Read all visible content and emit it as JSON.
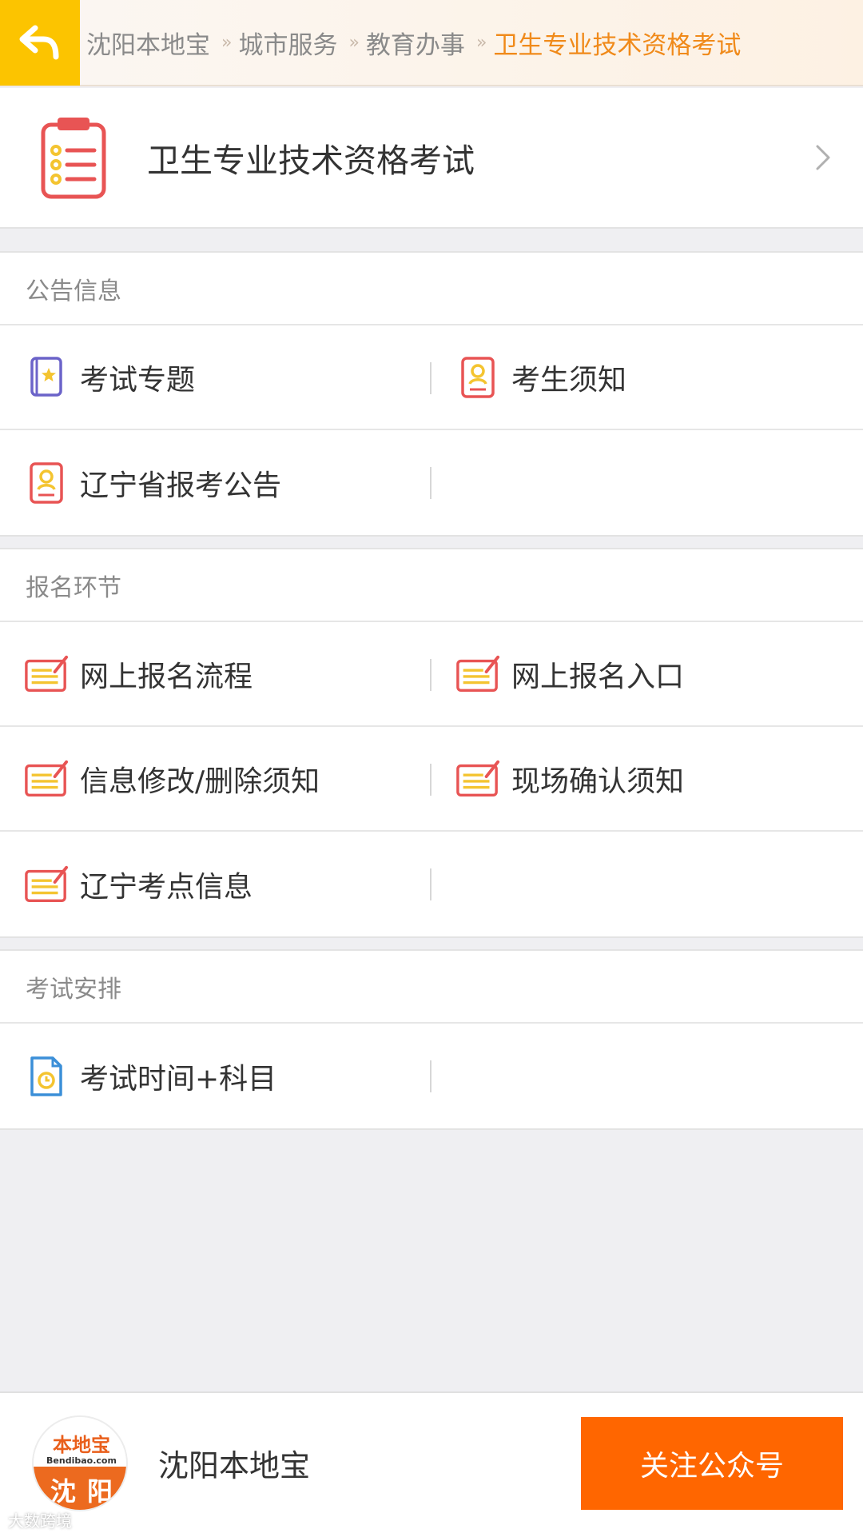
{
  "breadcrumb": {
    "items": [
      "沈阳本地宝",
      "城市服务",
      "教育办事",
      "卫生专业技术资格考试"
    ],
    "separator": "»"
  },
  "header": {
    "title": "卫生专业技术资格考试"
  },
  "sections": {
    "announcements": {
      "title": "公告信息",
      "items": [
        "考试专题",
        "考生须知",
        "辽宁省报考公告"
      ]
    },
    "registration": {
      "title": "报名环节",
      "items": [
        "网上报名流程",
        "网上报名入口",
        "信息修改/删除须知",
        "现场确认须知",
        "辽宁考点信息"
      ]
    },
    "schedule": {
      "title": "考试安排",
      "items": [
        "考试时间+科目"
      ]
    }
  },
  "footer": {
    "logo_cn": "本地宝",
    "logo_en": "Bendibao.com",
    "logo_city": "沈阳",
    "account_name": "沈阳本地宝",
    "follow_label": "关注公众号"
  },
  "watermark": "大数跨境",
  "colors": {
    "accent_yellow": "#fcc400",
    "breadcrumb_active": "#f08a1a",
    "follow_button": "#ff6600",
    "icon_red": "#e85454",
    "icon_yellow": "#f4c430",
    "icon_purple": "#6b63c9",
    "icon_blue": "#3b8fd8"
  }
}
